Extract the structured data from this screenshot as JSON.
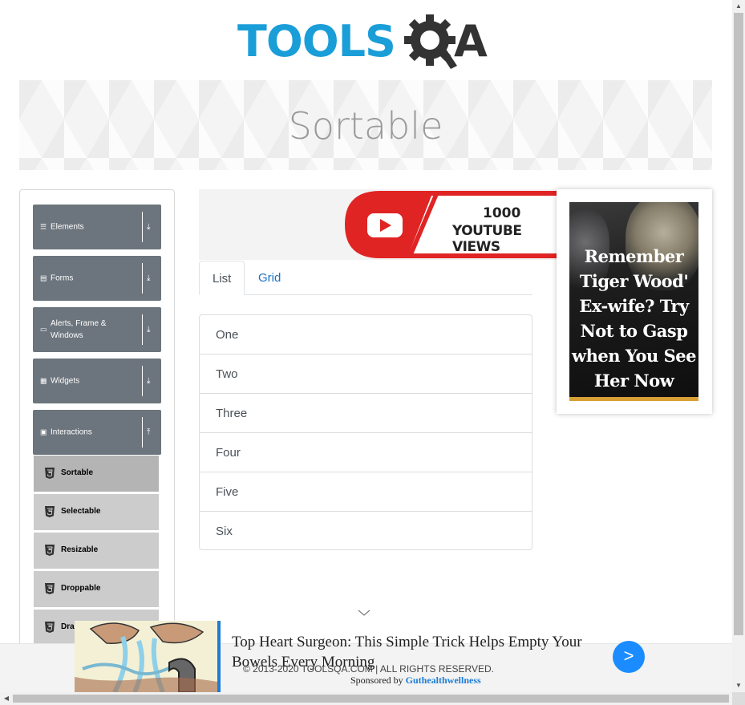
{
  "header": {
    "logo_text": "TOOLS",
    "logo_suffix": "A",
    "logo_alt": "TOOLSQA"
  },
  "banner": {
    "title": "Sortable"
  },
  "sidebar": {
    "groups": [
      {
        "label": "Elements",
        "icon": "hamburger-icon"
      },
      {
        "label": "Forms",
        "icon": "form-icon"
      },
      {
        "label": "Alerts, Frame & Windows",
        "icon": "window-icon"
      },
      {
        "label": "Widgets",
        "icon": "grid-icon"
      },
      {
        "label": "Interactions",
        "icon": "interactions-icon",
        "expanded": true
      }
    ],
    "items": [
      {
        "label": "Sortable",
        "active": true
      },
      {
        "label": "Selectable"
      },
      {
        "label": "Resizable"
      },
      {
        "label": "Droppable"
      },
      {
        "label": "Dra"
      }
    ]
  },
  "yt_ad": {
    "line1": "1000",
    "line2": "YOUTUBE VIEWS"
  },
  "tabs": [
    {
      "label": "List",
      "active": true
    },
    {
      "label": "Grid"
    }
  ],
  "list_items": [
    "One",
    "Two",
    "Three",
    "Four",
    "Five",
    "Six"
  ],
  "side_ad": {
    "text": "Remember Tiger Wood' Ex-wife? Try Not to Gasp when You See Her Now"
  },
  "footer": {
    "copyright": "© 2013-2020 TOOLSQA.COM | ALL RIGHTS RESERVED."
  },
  "bottom_ad": {
    "title": "Top Heart Surgeon: This Simple Trick Helps Empty Your Bowels Every Morning",
    "sponsored_prefix": "Sponsored by",
    "sponsor": "Guthealthwellness",
    "button_glyph": ">"
  },
  "colors": {
    "accent": "#1a9ed8",
    "sidebar_group": "#6c757d",
    "menu_item": "#cccccc",
    "menu_item_active": "#b4b4b4",
    "tab_link": "#1a73c8"
  }
}
